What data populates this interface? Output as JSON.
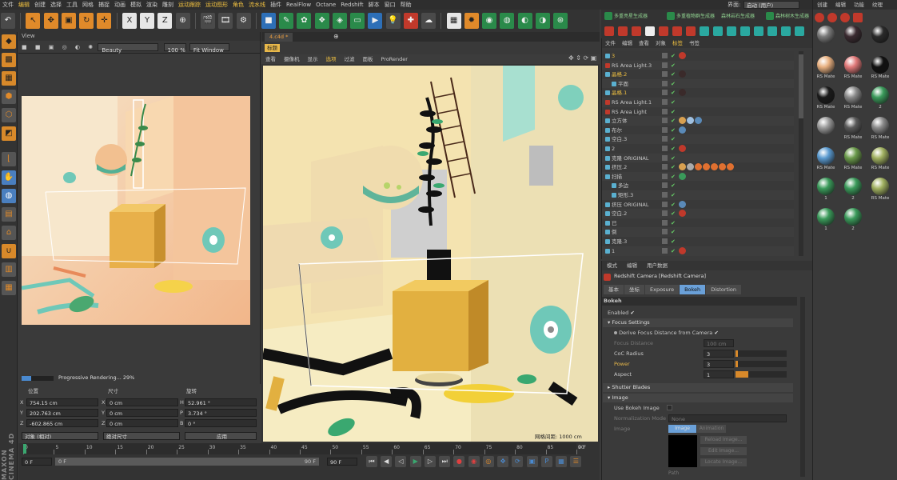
{
  "menu": [
    "文件",
    "编辑",
    "创建",
    "选择",
    "工具",
    "网格",
    "捕捉",
    "动画",
    "模拟",
    "渲染",
    "雕刻",
    "运动跟踪",
    "运动图形",
    "角色",
    "流水线",
    "插件",
    "RealFlow",
    "Octane",
    "Redshift",
    "脚本",
    "窗口",
    "帮助"
  ],
  "menu_highlight": [
    1,
    11,
    12,
    13,
    14
  ],
  "interface_label": "界面:",
  "interface_value": "启动 (用户)",
  "toolbar_axes": [
    "X",
    "Y",
    "Z"
  ],
  "plugin_buttons": [
    "多重亮星生成器",
    "多重植物群生成器",
    "森林岩石生成器",
    "森林树木生成器"
  ],
  "left_viewport": {
    "title": "View",
    "preset": "Beauty",
    "zoom": "100 %",
    "fit": "Fit Window",
    "status": "Progressive Rendering... 29%",
    "progress": 0.29
  },
  "main_viewport": {
    "tab": "4.c4d *",
    "label": "标题",
    "menus": [
      "查看",
      "摄像机",
      "显示",
      "选项",
      "过滤",
      "面板",
      "ProRender"
    ],
    "grid_label": "网格间距: 1000 cm"
  },
  "coords": {
    "headers": [
      "位置",
      "尺寸",
      "旋转"
    ],
    "rows": [
      {
        "a": "X",
        "pos": "754.15 cm",
        "size_axis": "X",
        "size": "0 cm",
        "rot_axis": "H",
        "rot": "52.961 °"
      },
      {
        "a": "Y",
        "pos": "202.763 cm",
        "size_axis": "Y",
        "size": "0 cm",
        "rot_axis": "P",
        "rot": "3.734 °"
      },
      {
        "a": "Z",
        "pos": "-602.865 cm",
        "size_axis": "Z",
        "size": "0 cm",
        "rot_axis": "B",
        "rot": "0 °"
      }
    ],
    "mode1": "对象 (相对)",
    "mode2": "绝对尺寸",
    "apply": "应用"
  },
  "timeline": {
    "ticks": [
      "0",
      "5",
      "10",
      "15",
      "20",
      "25",
      "30",
      "35",
      "40",
      "45",
      "50",
      "55",
      "60",
      "65",
      "70",
      "75",
      "80",
      "85",
      "90"
    ],
    "current": "0 F",
    "start": "0 F",
    "range_left": "0 F",
    "range_right": "90 F",
    "end": "90 F",
    "frame_field": "0 F"
  },
  "object_manager": {
    "menus": [
      "文件",
      "编辑",
      "查看",
      "对象",
      "标签",
      "书签"
    ],
    "objects": [
      {
        "name": "3",
        "indent": 0,
        "tags": [
          "#c0392b"
        ]
      },
      {
        "name": "RS Area Light.3",
        "indent": 0,
        "tags": []
      },
      {
        "name": "晶格.2",
        "indent": 0,
        "tags": [
          "#3a2a2a"
        ]
      },
      {
        "name": "平面",
        "indent": 1,
        "tags": []
      },
      {
        "name": "晶格.1",
        "indent": 0,
        "tags": [
          "#3a2a2a"
        ]
      },
      {
        "name": "RS Area Light.1",
        "indent": 0,
        "tags": []
      },
      {
        "name": "RS Area Light",
        "indent": 0,
        "tags": []
      },
      {
        "name": "立方体",
        "indent": 0,
        "tags": [
          "#d8a050",
          "#a0c0e0",
          "#5a8ab8"
        ]
      },
      {
        "name": "布尔",
        "indent": 0,
        "tags": [
          "#5a8ab8"
        ]
      },
      {
        "name": "空白.3",
        "indent": 0,
        "tags": []
      },
      {
        "name": "2",
        "indent": 0,
        "tags": [
          "#c0392b"
        ]
      },
      {
        "name": "克隆 ORIGINAL",
        "indent": 0,
        "tags": []
      },
      {
        "name": "挤压.2",
        "indent": 0,
        "tags": [
          "#d8a050",
          "#aaa",
          "#e07030",
          "#e07030",
          "#e07030",
          "#e07030",
          "#e07030"
        ]
      },
      {
        "name": "扫描",
        "indent": 0,
        "tags": [
          "#3a9a5a"
        ]
      },
      {
        "name": "多边",
        "indent": 1,
        "tags": []
      },
      {
        "name": "矩形.3",
        "indent": 1,
        "tags": []
      },
      {
        "name": "挤压 ORIGINAL",
        "indent": 0,
        "tags": [
          "#5a8ab8"
        ]
      },
      {
        "name": "空白.2",
        "indent": 0,
        "tags": [
          "#c0392b"
        ]
      },
      {
        "name": "已",
        "indent": 0,
        "tags": []
      },
      {
        "name": "倒",
        "indent": 0,
        "tags": []
      },
      {
        "name": "克隆.3",
        "indent": 0,
        "tags": []
      },
      {
        "name": "1",
        "indent": 0,
        "tags": [
          "#c0392b"
        ]
      }
    ]
  },
  "attributes": {
    "menus": [
      "模式",
      "编辑",
      "用户数据"
    ],
    "title": "Redshift Camera [Redshift Camera]",
    "tabs": [
      "基本",
      "坐标",
      "Exposure",
      "Bokeh",
      "Distortion"
    ],
    "active_tab": "Bokeh",
    "section": "Bokeh",
    "enabled_label": "Enabled",
    "focus_section": "Focus Settings",
    "derive_label": "Derive Focus Distance from Camera",
    "focus_distance_label": "Focus Distance",
    "focus_distance": "100 cm",
    "coc_label": "CoC Radius",
    "coc": "3",
    "coc_fill": 0.05,
    "power_label": "Power",
    "power": "3",
    "power_fill": 0.05,
    "aspect_label": "Aspect",
    "aspect": "1",
    "aspect_fill": 0.25,
    "shutter_section": "Shutter Blades",
    "image_section": "Image",
    "use_bokeh_label": "Use Bokeh Image",
    "norm_label": "Normalization Mode",
    "norm_value": "None",
    "image_label": "Image",
    "image_tabs": [
      "Image",
      "Animation"
    ],
    "reload": "Reload Image...",
    "edit": "Edit Image...",
    "locate": "Locate Image...",
    "path": "Path"
  },
  "material_manager": {
    "menus": [
      "创建",
      "编辑",
      "功能",
      "纹理"
    ],
    "materials": [
      {
        "label": "",
        "color": "#7a7a7a"
      },
      {
        "label": "",
        "color": "#3a2a30"
      },
      {
        "label": "",
        "color": "#2a2a2a"
      },
      {
        "label": "RS Mate",
        "color": "#e8b080"
      },
      {
        "label": "RS Mate",
        "color": "#e07878"
      },
      {
        "label": "RS Mate",
        "color": "#111111"
      },
      {
        "label": "RS Mate",
        "color": "#1a1a1a"
      },
      {
        "label": "RS Mate",
        "color": "#8a8a8a"
      },
      {
        "label": "2",
        "color": "#3a9a5a"
      },
      {
        "label": "",
        "color": "#9a9a9a"
      },
      {
        "label": "RS Mate",
        "color": "#5a5a5a"
      },
      {
        "label": "RS Mate",
        "color": "#8a8a8a"
      },
      {
        "label": "RS Mate",
        "color": "#5a9ad0"
      },
      {
        "label": "RS Mate",
        "color": "#6a9a4a"
      },
      {
        "label": "RS Mate",
        "color": "#a0b060"
      },
      {
        "label": "1",
        "color": "#3a9a5a"
      },
      {
        "label": "2",
        "color": "#3a9a5a"
      },
      {
        "label": "RS Mate",
        "color": "#a0b060"
      },
      {
        "label": "1",
        "color": "#3a9a5a"
      },
      {
        "label": "2",
        "color": "#3a9a5a"
      }
    ]
  },
  "colors": {
    "accent": "#d8892a",
    "selection": "#6aa0d8",
    "bg": "#3a3a3a",
    "scene_bg": "#f5e6b8"
  }
}
